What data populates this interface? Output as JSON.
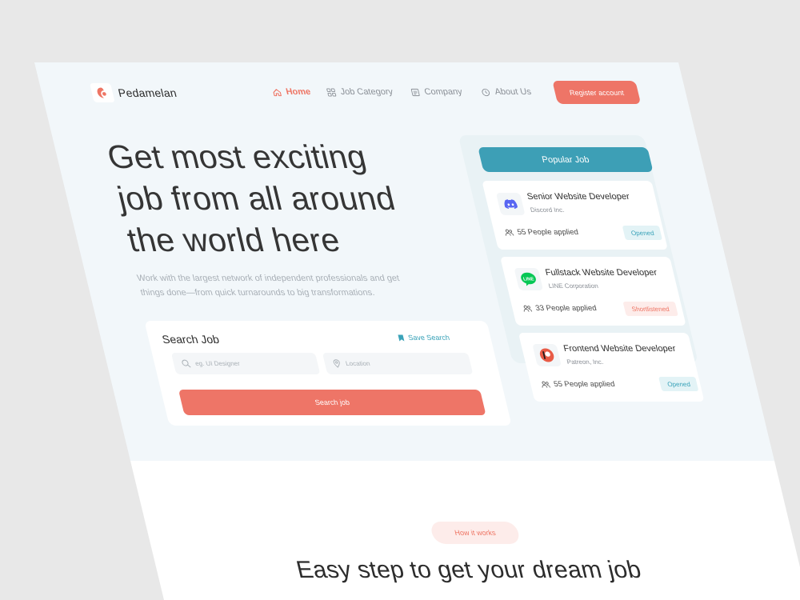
{
  "brand": {
    "name": "Pedamelan",
    "color": "#ee7564"
  },
  "nav": {
    "items": [
      {
        "label": "Home",
        "icon": "home-icon",
        "active": true
      },
      {
        "label": "Job Category",
        "icon": "grid-icon",
        "active": false
      },
      {
        "label": "Company",
        "icon": "building-icon",
        "active": false
      },
      {
        "label": "About Us",
        "icon": "clock-icon",
        "active": false
      }
    ],
    "register_label": "Register account"
  },
  "hero": {
    "headline_lines": [
      "Get most exciting",
      "job from all around",
      "the world here"
    ],
    "subtitle_lines": [
      "Work with the largest network of independent professionals and get",
      "things done—from quick turnarounds to big transformations."
    ]
  },
  "search": {
    "title": "Search Job",
    "save_label": "Save Search",
    "keyword_placeholder": "eg. UI Designer",
    "location_placeholder": "Location",
    "button_label": "Search job"
  },
  "popular": {
    "header": "Popular Job",
    "jobs": [
      {
        "title": "Senior Website Developer",
        "company": "Discord Inc.",
        "applied": "55 People applied",
        "status": "Opened",
        "logo": "discord-logo"
      },
      {
        "title": "Fullstack Website Developer",
        "company": "LINE Corporation",
        "applied": "33 People applied",
        "status": "Shortlistened",
        "logo": "line-logo"
      },
      {
        "title": "Frontend Website Developer",
        "company": "Patreon, Inc.",
        "applied": "55 People applied",
        "status": "Opened",
        "logo": "patreon-logo"
      }
    ]
  },
  "how": {
    "pill_label": "How it works",
    "title": "Easy step to get your dream job"
  },
  "colors": {
    "accent": "#ee7567",
    "teal": "#3d9fb6",
    "opened_bg": "#e3f3f6",
    "opened_text": "#3ba3b9",
    "shortlist_bg": "#fdecea",
    "shortlist_text": "#ee7564"
  }
}
